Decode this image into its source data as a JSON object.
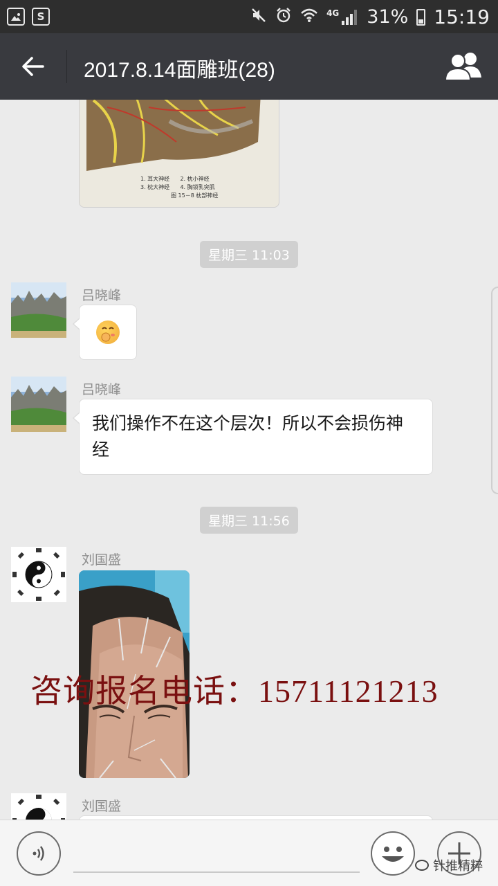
{
  "status_bar": {
    "network": "4G",
    "battery": "31%",
    "time": "15:19"
  },
  "header": {
    "title": "2017.8.14面雕班(28)"
  },
  "messages": {
    "top_image_caption": {
      "l1": "1. 耳大神经",
      "l2": "2. 枕小神经",
      "l3": "3. 枕大神经",
      "l4": "4. 胸锁乳突肌",
      "fig": "图 15－8  枕部神经"
    },
    "time1": "星期三 11:03",
    "msg1": {
      "sender": "吕晓峰"
    },
    "msg2": {
      "sender": "吕晓峰",
      "text": "我们操作不在这个层次！所以不会损伤神经"
    },
    "time2": "星期三 11:56",
    "msg3": {
      "sender": "刘国盛"
    },
    "msg4": {
      "sender": "刘国盛"
    }
  },
  "watermark": "咨询报名电话：15711121213",
  "input_bar": {
    "brand": "针推精粹"
  },
  "colors": {
    "header_bg": "#393a3f",
    "chat_bg": "#ebebeb",
    "watermark": "#7a1010"
  }
}
